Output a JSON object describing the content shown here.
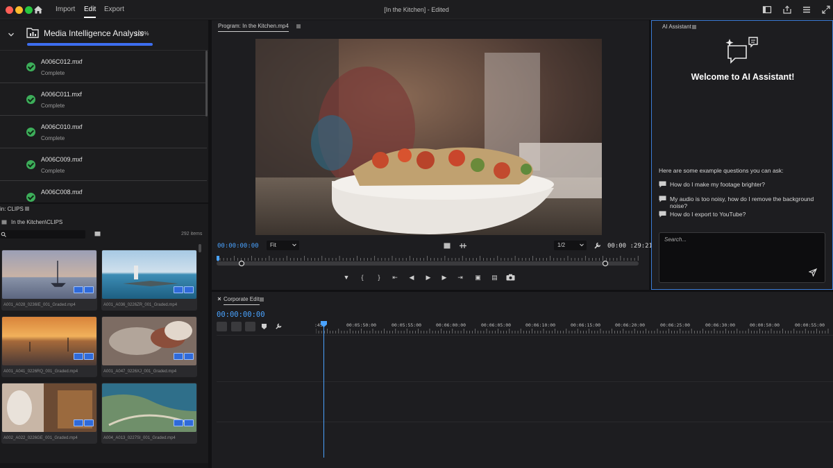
{
  "window": {
    "menu": {
      "import": "Import",
      "edit": "Edit",
      "export": "Export"
    },
    "title": "[In the Kitchen] - Edited"
  },
  "media_intelligence": {
    "title": "Media Intelligence Analysis",
    "percent": "100%",
    "progress": 1.0,
    "items": [
      {
        "name": "A006C012.mxf",
        "status": "Complete"
      },
      {
        "name": "A006C011.mxf",
        "status": "Complete"
      },
      {
        "name": "A006C010.mxf",
        "status": "Complete"
      },
      {
        "name": "A006C009.mxf",
        "status": "Complete"
      },
      {
        "name": "A006C008.mxf",
        "status": ""
      }
    ]
  },
  "bin": {
    "tab_label": "in: CLIPS",
    "path": "In the Kitchen\\CLIPS",
    "item_count": "292 items",
    "thumbnails": [
      {
        "label": "A001_A028_0236IE_001_Graded.mp4"
      },
      {
        "label": "A001_A036_0226ZR_001_Graded.mp4"
      },
      {
        "label": "A001_A041_0226RQ_001_Graded.mp4"
      },
      {
        "label": "A001_A047_0226XJ_001_Graded.mp4"
      },
      {
        "label": "A002_A022_0226GE_001_Graded.mp4"
      },
      {
        "label": "A004_A013_0227SI_001_Graded.mp4"
      }
    ]
  },
  "program": {
    "tab_label": "Program: In the Kitchen.mp4",
    "timecode": "00:00:00:00",
    "fit_label": "Fit",
    "quality_label": "1/2",
    "duration": "00:00 :29:21"
  },
  "ai_assistant": {
    "tab_label": "AI Assistant",
    "welcome": "Welcome to AI Assistant!",
    "intro": "Here are some example questions you can ask:",
    "questions": [
      "How do I make my footage brighter?",
      "My audio is too noisy, how do I remove the background noise?",
      "How do I export to YouTube?"
    ],
    "search_placeholder": "Search..."
  },
  "timeline": {
    "tab_label": "Corporate Edit",
    "timecode": "00:00:00:00",
    "ticks": [
      ":45",
      "00:05:50:00",
      "00:05:55:00",
      "00:06:00:00",
      "00:06:05:00",
      "00:06:10:00",
      "00:06:15:00",
      "00:06:20:00",
      "00:06:25:00",
      "00:06:30:00",
      "00:00:50:00",
      "00:00:55:00"
    ]
  }
}
